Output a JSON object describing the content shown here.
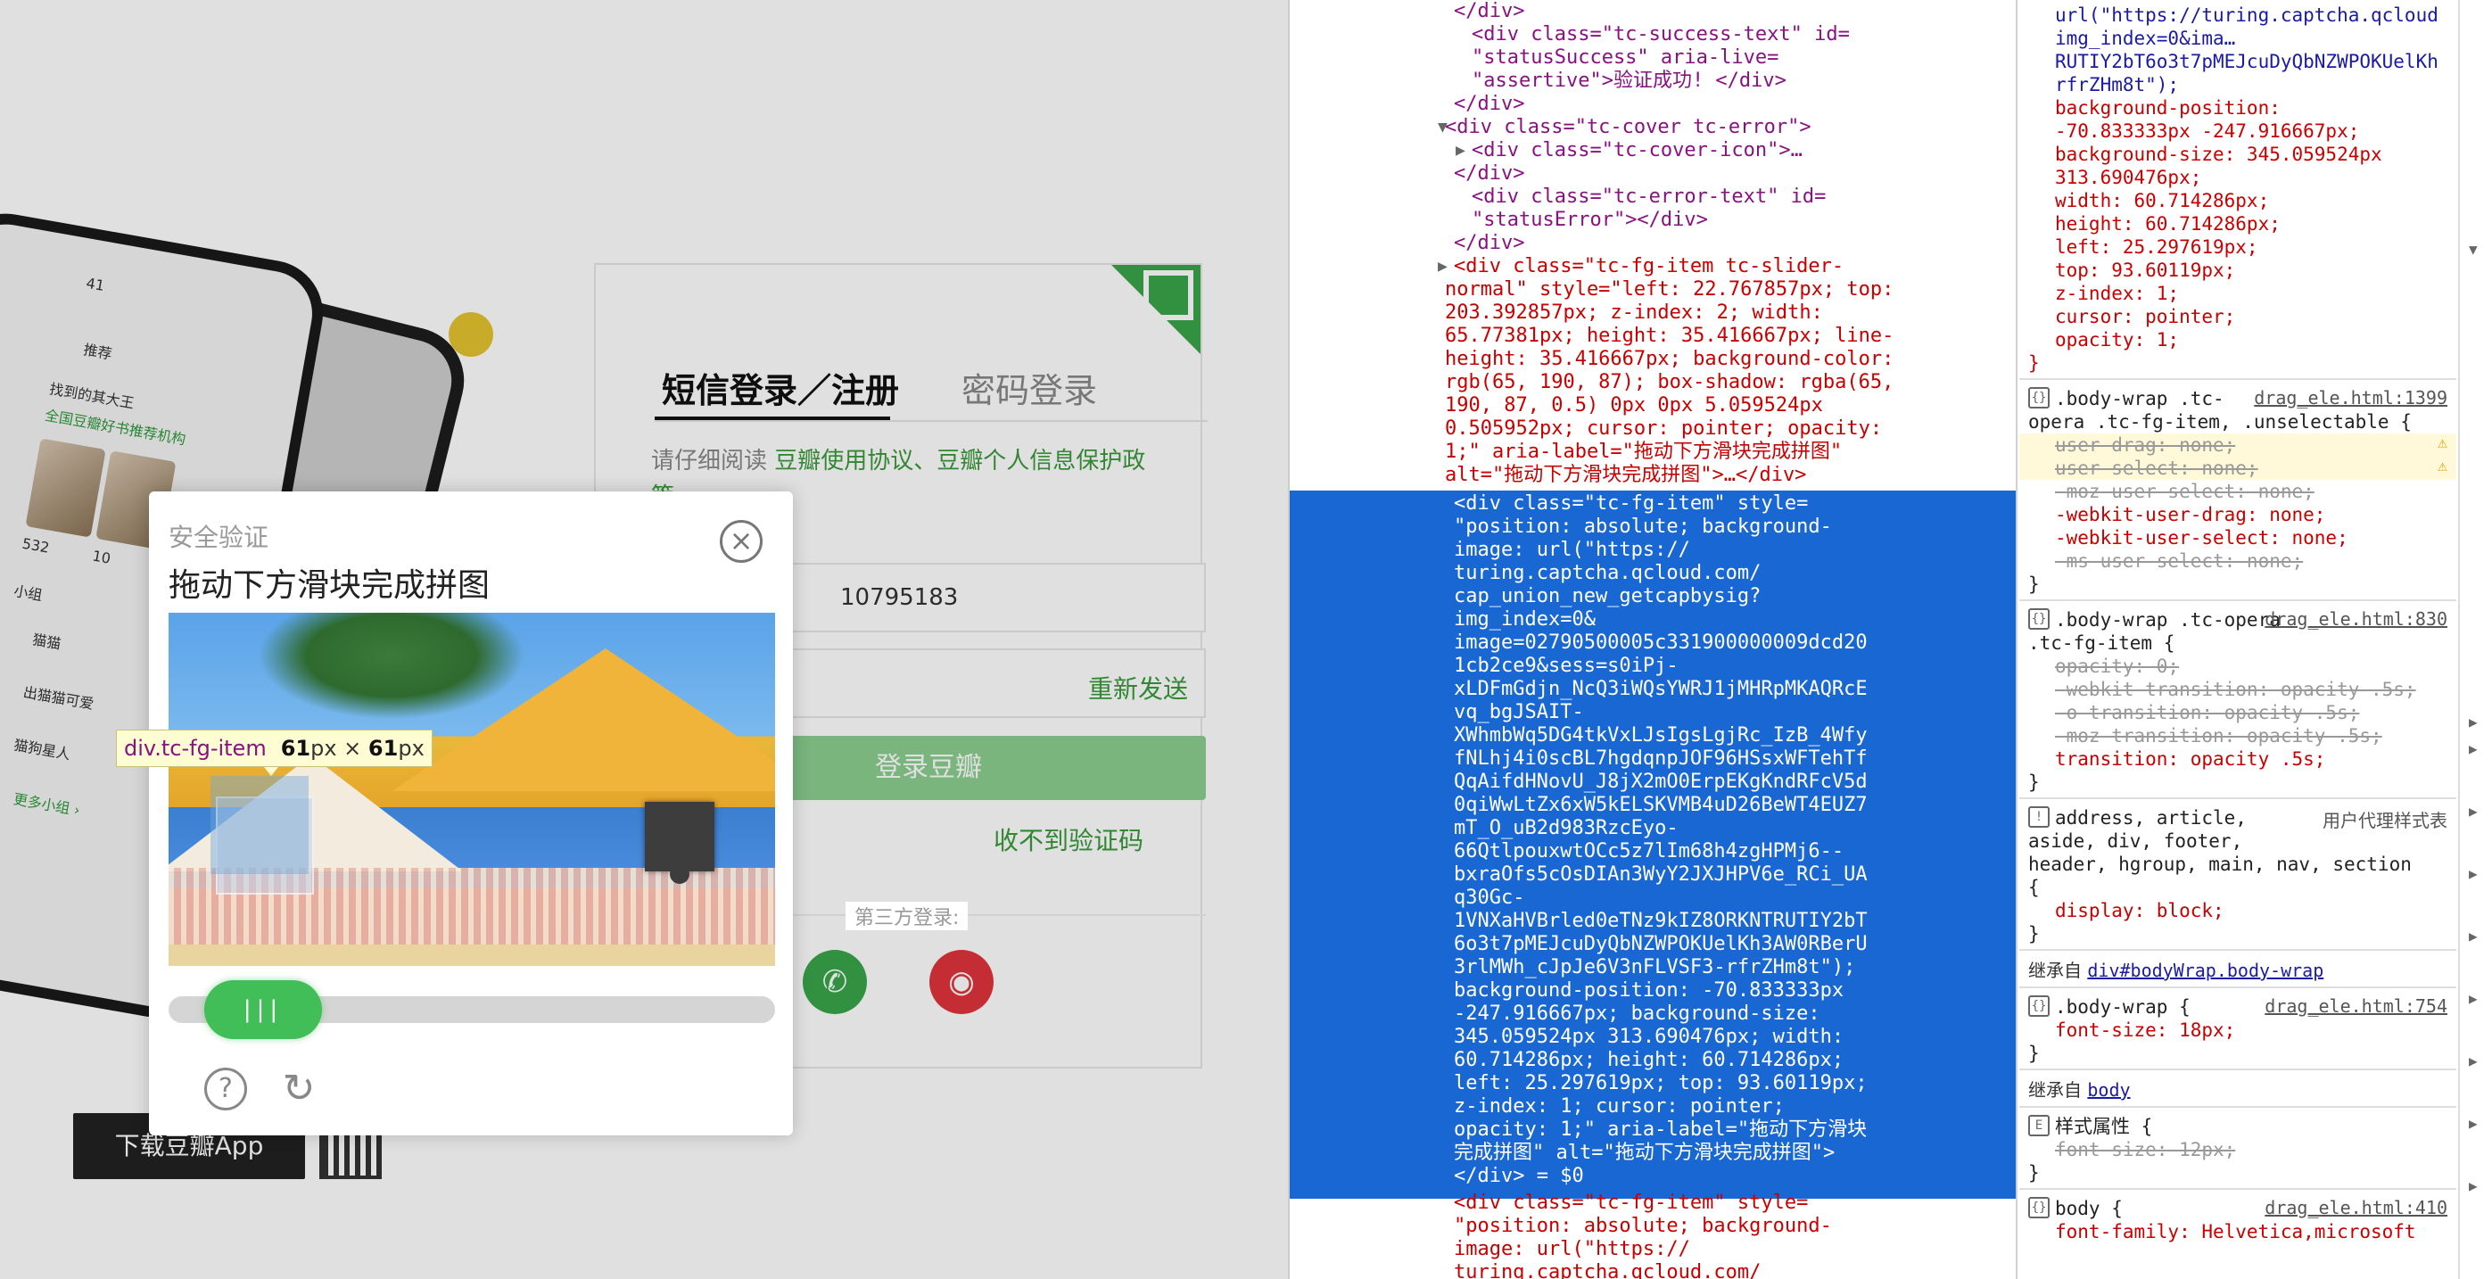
{
  "page": {
    "tabs": {
      "sms": "短信登录／注册",
      "password": "密码登录"
    },
    "agree": {
      "prefix": "请仔细阅读 ",
      "links": "豆瓣使用协议、豆瓣个人信息保护政",
      "wrap": "策"
    },
    "phone_value": "10795183",
    "resend_label": "重新发送",
    "login_button": "登录豆瓣",
    "no_code_label": "收不到验证码",
    "third_party_label": "第三方登录:",
    "download_button": "下载豆瓣App",
    "phone_mock": {
      "time": "41",
      "tab": "推荐",
      "line1": "找到的其大王",
      "line2": "全国豆瓣好书推荐机构",
      "stat1": "532",
      "stat2": "10",
      "line3": "小组",
      "line4": "猫猫",
      "line5": "出猫猫可爱",
      "line6": "猫狗星人",
      "more": "更多小组 ›"
    }
  },
  "captcha": {
    "label": "安全验证",
    "title": "拖动下方滑块完成拼图",
    "slider_grip": "|||",
    "help": "?",
    "refresh": "↻",
    "close": "×"
  },
  "tooltip": {
    "tag": "div.tc-fg-item",
    "w": "61",
    "h": "61",
    "unit": "px",
    "sep": " × "
  },
  "devtools": {
    "elements_lines": [
      "</div>",
      "<div class=\"tc-success-text\" id=",
      "\"statusSuccess\" aria-live=",
      "\"assertive\">验证成功! </div>",
      "</div>",
      "<div class=\"tc-cover tc-error\">",
      "<div class=\"tc-cover-icon\">…",
      "</div>",
      "<div class=\"tc-error-text\" id=",
      "\"statusError\"></div>",
      "</div>"
    ],
    "red_lines": [
      "<div class=\"tc-fg-item tc-slider-",
      "normal\" style=\"left: 22.767857px; top:",
      "203.392857px; z-index: 2; width:",
      "65.77381px; height: 35.416667px; line-",
      "height: 35.416667px; background-color:",
      "rgb(65, 190, 87); box-shadow: rgba(65,",
      "190, 87, 0.5) 0px 0px 5.059524px",
      "0.505952px; cursor: pointer; opacity:",
      "1;\" aria-label=\"拖动下方滑块完成拼图\"",
      "alt=\"拖动下方滑块完成拼图\">…</div>"
    ],
    "selected_lines": [
      "<div class=\"tc-fg-item\" style=",
      "\"position: absolute; background-",
      "image: url(\"https://",
      "turing.captcha.qcloud.com/",
      "cap_union_new_getcapbysig?",
      "img_index=0&",
      "image=02790500005c331900000009dcd20",
      "1cb2ce9&sess=s0iPj-",
      "xLDFmGdjn_NcQ3iWQsYWRJ1jMHRpMKAQRcE",
      "vq_bgJSAIT-",
      "XWhmbWq5DG4tkVxLJsIgsLgjRc_IzB_4Wfy",
      "fNLhj4i0scBL7hgdqnpJOF96HSsxWFTehTf",
      "QqAifdHNovU_J8jX2mO0ErpEKgKndRFcV5d",
      "0qiWwLtZx6xW5kELSKVMB4uD26BeWT4EUZ7",
      "mT_O_uB2d983RzcEyo-",
      "66QtlpouxwtOCc5z7lIm68h4zgHPMj6--",
      "bxraOfs5cOsDIAn3WyY2JXJHPV6e_RCi_UA",
      "q30Gc-",
      "1VNXaHVBrled0eTNz9kIZ8ORKNTRUTIY2bT",
      "6o3t7pMEJcuDyQbNZWPOKUelKh3AW0RBerU",
      "3rlMWh_cJpJe6V3nFLVSF3-rfrZHm8t\");",
      "background-position: -70.833333px",
      "-247.916667px; background-size:",
      "345.059524px 313.690476px; width:",
      "60.714286px; height: 60.714286px;",
      "left: 25.297619px; top: 93.60119px;",
      "z-index: 1; cursor: pointer;",
      "opacity: 1;\" aria-label=\"拖动下方滑块",
      "完成拼图\" alt=\"拖动下方滑块完成拼图\">",
      "</div> = $0"
    ],
    "bottom_lines": [
      "<div class=\"tc-fg-item\" style=",
      "\"position: absolute; background-",
      "image: url(\"https://",
      "turing.captcha.qcloud.com/"
    ],
    "styles": {
      "top_lines": [
        "url(\"https://turing.captcha.qcloud",
        "img_index=0&ima…",
        "RUTIY2bT6o3t7pMEJcuDyQbNZWPOKUelKh",
        "rfrZHm8t\");",
        "background-position:",
        "-70.833333px -247.916667px;",
        "background-size: 345.059524px",
        "313.690476px;",
        "width: 60.714286px;",
        "height: 60.714286px;",
        "left: 25.297619px;",
        "top: 93.60119px;",
        "z-index: 1;",
        "cursor: pointer;",
        "opacity: 1;",
        "}"
      ],
      "rule1_sel": ".body-wrap .tc-",
      "rule1_sel2": "opera .tc-fg-item, .unselectable {",
      "rule1_src": "drag_ele.html:1399",
      "rule1_props": [
        "user-drag: none;",
        "user-select: none;",
        "-moz-user-select: none;",
        "-webkit-user-drag: none;",
        "-webkit-user-select: none;",
        "-ms-user-select: none;",
        "}"
      ],
      "rule2_sel": ".body-wrap .tc-opera",
      "rule2_sel2": ".tc-fg-item {",
      "rule2_src": "drag_ele.html:830",
      "rule2_props": [
        "opacity: 0;",
        "-webkit-transition: opacity .5s;",
        "-o-transition: opacity .5s;",
        "-moz-transition: opacity .5s;",
        "transition: opacity .5s;",
        "}"
      ],
      "rule3_sel": "address, article,",
      "rule3_ua": "用户代理样式表",
      "rule3_sel2": "aside, div, footer,",
      "rule3_sel3": "header, hgroup, main, nav, section",
      "rule3_open": "{",
      "rule3_prop": "display: block;",
      "rule3_close": "}",
      "inherit1": "继承自 ",
      "inherit1_link": "div#bodyWrap.body-wrap",
      "rule4_sel": ".body-wrap {",
      "rule4_src": "drag_ele.html:754",
      "rule4_prop": "font-size: 18px;",
      "rule4_close": "}",
      "inherit2": "继承自 ",
      "inherit2_link": "body",
      "rule5_sel": "样式属性 {",
      "rule5_prop": "font-size: 12px;",
      "rule5_close": "}",
      "rule6_sel": "body {",
      "rule6_src": "drag_ele.html:410",
      "rule6_prop": "font-family: Helvetica,microsoft"
    }
  }
}
